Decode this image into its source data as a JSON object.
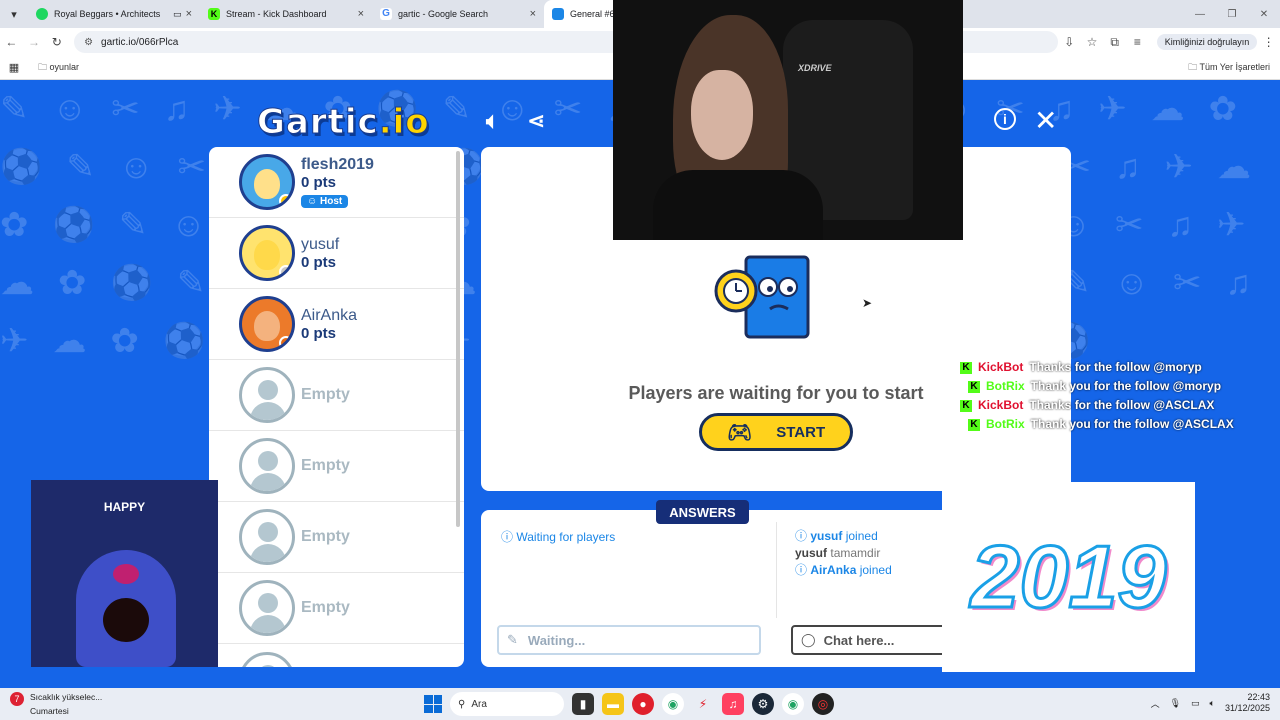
{
  "browser": {
    "tabs": [
      {
        "title": "Royal Beggars • Architects",
        "color": "#1ed760"
      },
      {
        "title": "Stream - Kick Dashboard",
        "color": "#53fc18"
      },
      {
        "title": "gartic - Google Search",
        "color": "#4285f4"
      },
      {
        "title": "General #6rPlca (English)",
        "color": "#1b86e6"
      }
    ],
    "url": "gartic.io/066rPlca",
    "verify_label": "Kimliğinizi doğrulayın",
    "bookmark_folder": "oyunlar",
    "all_bookmarks": "Tüm Yer İşaretleri"
  },
  "game": {
    "logo_main": "Gartic",
    "logo_io": ".io",
    "players": [
      {
        "name": "flesh2019",
        "pts": "0 pts",
        "host": "Host",
        "dot": "#ffc400",
        "skin": "#ffe08a",
        "ring": "#1f3f8f"
      },
      {
        "name": "yusuf",
        "pts": "0 pts",
        "dot": "#c8c8c8",
        "skin": "#ffd94a",
        "ring": "#1f3f8f"
      },
      {
        "name": "AirAnka",
        "pts": "0 pts",
        "dot": "#e36a14",
        "skin": "#f4a56a",
        "ring": "#1f3f8f"
      }
    ],
    "empty_label": "Empty",
    "waiting_message": "Players are waiting for you to start",
    "start_label": "START",
    "answers_tab": "ANSWERS",
    "answers_status": "Waiting for players",
    "answers_placeholder": "Waiting...",
    "chat_placeholder": "Chat here...",
    "chat_log": {
      "line1_name": "yusuf",
      "line1_text": "joined",
      "line2_name": "yusuf",
      "line2_text": "tamamdir",
      "line3_name": "AirAnka",
      "line3_text": "joined"
    }
  },
  "overlays": {
    "webcam_brand": "XDRIVE",
    "kick_chat": [
      {
        "user": "KickBot",
        "msg": "Thanks for the follow @moryp",
        "color": "#e0102f"
      },
      {
        "user": "BotRix",
        "msg": "Thank you for the follow @moryp",
        "color": "#53fc18"
      },
      {
        "user": "KickBot",
        "msg": "Thanks for the follow @ASCLAX",
        "color": "#e0102f"
      },
      {
        "user": "BotRix",
        "msg": "Thank you for the follow @ASCLAX",
        "color": "#53fc18"
      }
    ],
    "gif_caption": "HAPPY",
    "year_text": "2019"
  },
  "taskbar": {
    "weather_title": "Sıcaklık yükselec...",
    "weather_sub": "Cumartesi",
    "weather_badge": "7",
    "search_label": "Ara",
    "time": "22:43",
    "date": "31/12/2025"
  }
}
